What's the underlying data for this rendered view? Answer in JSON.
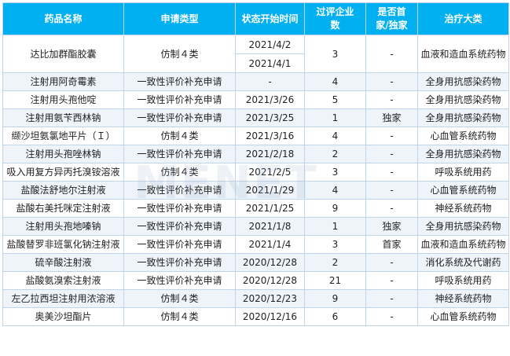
{
  "table": {
    "headers": {
      "name": "药品名称",
      "type": "申请类型",
      "start": "状态开始时间",
      "count": "过评企业数",
      "first": "是否首家/独家",
      "category": "治疗大类"
    },
    "first_row": {
      "name": "达比加群酯胶囊",
      "type": "仿制４类",
      "start_dates": [
        "2021/4/2",
        "2021/4/1"
      ],
      "count": "3",
      "first": "-",
      "category": "血液和造血系统药物"
    },
    "rows": [
      {
        "name": "注射用阿奇霉素",
        "type": "一致性评价补充申请",
        "start": "-",
        "count": "4",
        "first": "-",
        "category": "全身用抗感染药物"
      },
      {
        "name": "注射用头孢他啶",
        "type": "一致性评价补充申请",
        "start": "2021/3/26",
        "count": "5",
        "first": "-",
        "category": "全身用抗感染药物"
      },
      {
        "name": "注射用氨苄西林钠",
        "type": "一致性评价补充申请",
        "start": "2021/3/25",
        "count": "1",
        "first": "独家",
        "category": "全身用抗感染药物"
      },
      {
        "name": "缬沙坦氨氯地平片（Ｉ）",
        "type": "仿制４类",
        "start": "2021/3/16",
        "count": "4",
        "first": "-",
        "category": "心血管系统药物"
      },
      {
        "name": "注射用头孢唑林钠",
        "type": "一致性评价补充申请",
        "start": "2021/2/18",
        "count": "2",
        "first": "-",
        "category": "全身用抗感染药物"
      },
      {
        "name": "吸入用复方异丙托溴铵溶液",
        "type": "仿制４类",
        "start": "2021/2/5",
        "count": "3",
        "first": "-",
        "category": "呼吸系统用药"
      },
      {
        "name": "盐酸法舒地尔注射液",
        "type": "一致性评价补充申请",
        "start": "2021/1/29",
        "count": "4",
        "first": "-",
        "category": "心血管系统药物"
      },
      {
        "name": "盐酸右美托咪定注射液",
        "type": "一致性评价补充申请",
        "start": "2021/1/25",
        "count": "9",
        "first": "-",
        "category": "神经系统药物"
      },
      {
        "name": "注射用头孢地嗪钠",
        "type": "一致性评价补充申请",
        "start": "2021/1/8",
        "count": "1",
        "first": "独家",
        "category": "全身用抗感染药物"
      },
      {
        "name": "盐酸替罗非班氯化钠注射液",
        "type": "一致性评价补充申请",
        "start": "2021/1/4",
        "count": "3",
        "first": "首家",
        "category": "血液和造血系统药物"
      },
      {
        "name": "硫辛酸注射液",
        "type": "一致性评价补充申请",
        "start": "2020/12/28",
        "count": "2",
        "first": "-",
        "category": "消化系统及代谢药"
      },
      {
        "name": "盐酸氨溴索注射液",
        "type": "一致性评价补充申请",
        "start": "2020/12/28",
        "count": "21",
        "first": "-",
        "category": "呼吸系统用药"
      },
      {
        "name": "左乙拉西坦注射用浓溶液",
        "type": "仿制４类",
        "start": "2020/12/23",
        "count": "9",
        "first": "-",
        "category": "神经系统药物"
      },
      {
        "name": "奥美沙坦酯片",
        "type": "仿制４类",
        "start": "2020/12/16",
        "count": "6",
        "first": "-",
        "category": "心血管系统药物"
      }
    ]
  },
  "watermark": "MENET",
  "colors": {
    "header_bg": "#00b0f0",
    "header_text": "#ffffff",
    "row_alt_bg": "#eef4fa",
    "border": "#bfd6ea"
  }
}
